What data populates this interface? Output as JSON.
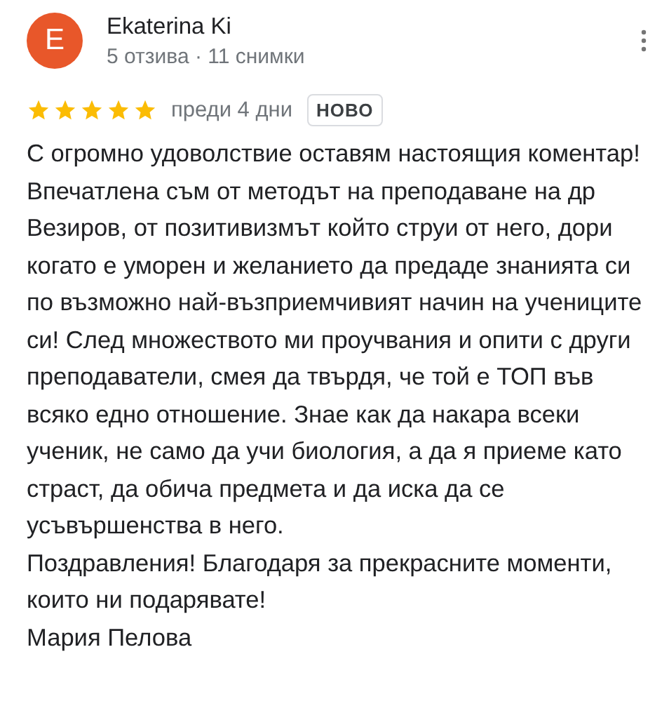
{
  "review": {
    "avatar_letter": "E",
    "author": "Ekaterina Ki",
    "author_stats": "5 отзива · 11 снимки",
    "stars": 5,
    "time": "преди 4 дни",
    "badge": "НОВО",
    "paragraphs": [
      "С огромно удоволствие оставям настоящия коментар! Впечатлена съм от методът на преподаване на др Везиров, от позитивизмът който струи от него, дори когато е уморен и желанието да предаде знанията си по възможно най-възприемчивият начин на учениците си! След множеството ми проучвания и опити с други преподаватели, смея да твърдя, че той е ТОП във всяко едно отношение. Знае как да накара всеки ученик, не само да учи биология, а да я приеме като страст, да обича предмета и да иска да се усъвършенства в него.",
      "Поздравления! Благодаря за прекрасните моменти, които ни подарявате!",
      "Мария Пелова"
    ]
  }
}
